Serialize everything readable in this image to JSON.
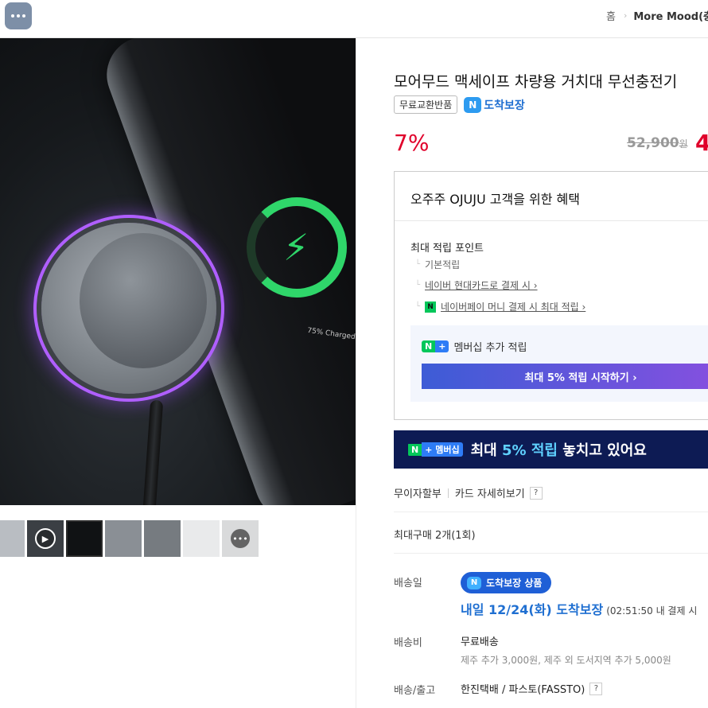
{
  "topbar": {
    "menu_icon": "more-dots-icon",
    "breadcrumb_home": "홈",
    "breadcrumb_separator": "›",
    "breadcrumb_store": "More Mood(충"
  },
  "gallery": {
    "main_image_text": "75% Charged",
    "thumbnails": [
      "thumb-1",
      "video-thumb",
      "thumb-3",
      "thumb-4",
      "thumb-5",
      "thumb-6",
      "more-thumb"
    ],
    "play_icon": "play-icon",
    "more_icon": "more-icon",
    "more_label": "•••"
  },
  "product": {
    "title": "모어무드 맥세이프 차량용 거치대 무선충전기",
    "badge_free_return": "무료교환반품",
    "badge_guarantee_logo": "N",
    "badge_guarantee": "도착보장",
    "discount": "7%",
    "original_price": "52,900",
    "original_price_unit": "원",
    "sale_price": "4"
  },
  "benefit": {
    "title": "오주주 OJUJU 고객을 위한 혜택",
    "points_head": "최대 적립 포인트",
    "rows": [
      {
        "text": "기본적립"
      },
      {
        "text": "네이버 현대카드로 결제 시 ›"
      },
      {
        "text": "네이버페이 머니 결제 시 최대 적립 ›"
      }
    ],
    "npay_icon_label": "N",
    "membership_badge_n": "N",
    "membership_badge_plus": "+",
    "membership_label": "멤버십 추가 적립",
    "membership_button": "최대 5% 적립 시작하기 ›"
  },
  "banner": {
    "badge_n": "N",
    "badge_plus": "+ 멤버십",
    "text_before": "최대 ",
    "text_highlight": "5% 적립",
    "text_after": " 놓치고 있어요"
  },
  "info": {
    "installment": "무이자할부",
    "card_detail": "카드 자세히보기",
    "help_mark": "?",
    "max_purchase": "최대구매 2개(1회)",
    "delivery_label": "배송일",
    "delivery_pill_logo": "N",
    "delivery_pill": "도착보장 상품",
    "arrival": "내일 12/24(화) 도착보장",
    "arrival_note": "(02:51:50 내 결제 시",
    "fee_label": "배송비",
    "fee": "무료배송",
    "fee_extra": "제주 추가 3,000원, 제주 외 도서지역 추가 5,000원",
    "courier_label": "배송/출고",
    "courier": "한진택배 / 파스토(FASSTO)"
  },
  "colors": {
    "price_red": "#e0002a",
    "guarantee_blue": "#1f6fd1",
    "naver_green": "#03c75a",
    "banner_navy": "#0d1b54"
  }
}
